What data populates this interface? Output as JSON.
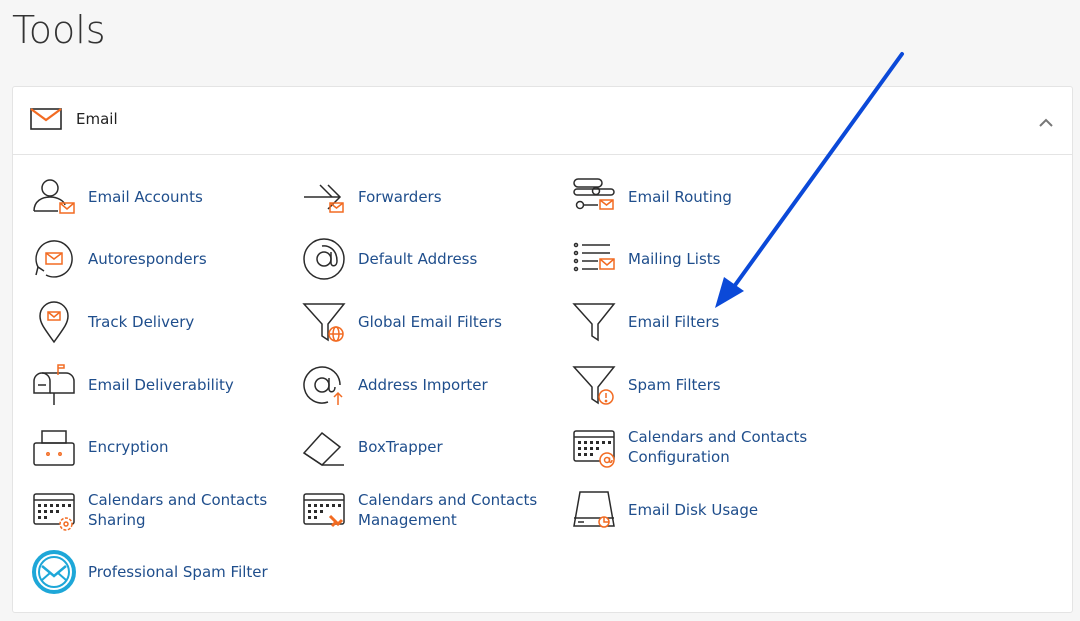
{
  "page": {
    "title": "Tools"
  },
  "section": {
    "title": "Email",
    "icons": {
      "header": "envelope-icon",
      "collapse": "chevron-up-icon"
    }
  },
  "tools": [
    {
      "label": "Email Accounts",
      "icon": "user-mail-icon"
    },
    {
      "label": "Forwarders",
      "icon": "forward-arrow-icon"
    },
    {
      "label": "Email Routing",
      "icon": "routing-icon"
    },
    {
      "label": "Autoresponders",
      "icon": "autoresponder-icon"
    },
    {
      "label": "Default Address",
      "icon": "at-sign-icon"
    },
    {
      "label": "Mailing Lists",
      "icon": "list-mail-icon"
    },
    {
      "label": "Track Delivery",
      "icon": "location-pin-icon"
    },
    {
      "label": "Global Email Filters",
      "icon": "funnel-globe-icon"
    },
    {
      "label": "Email Filters",
      "icon": "funnel-icon"
    },
    {
      "label": "Email Deliverability",
      "icon": "mailbox-icon"
    },
    {
      "label": "Address Importer",
      "icon": "at-import-icon"
    },
    {
      "label": "Spam Filters",
      "icon": "funnel-warning-icon"
    },
    {
      "label": "Encryption",
      "icon": "lock-box-icon"
    },
    {
      "label": "BoxTrapper",
      "icon": "box-trap-icon"
    },
    {
      "label": "Calendars and Contacts Configuration",
      "icon": "calendar-at-icon"
    },
    {
      "label": "Calendars and Contacts Sharing",
      "icon": "calendar-gear-icon"
    },
    {
      "label": "Calendars and Contacts Management",
      "icon": "calendar-pen-icon"
    },
    {
      "label": "Email Disk Usage",
      "icon": "disk-usage-icon"
    },
    {
      "label": "Professional Spam Filter",
      "icon": "spam-shield-icon"
    }
  ],
  "colors": {
    "accent": "#f26b22",
    "link": "#1f4e8c",
    "icon_stroke": "#2b2b2b",
    "annotation_arrow": "#0b49d8",
    "spam_filter_blue": "#1ea7d8"
  }
}
